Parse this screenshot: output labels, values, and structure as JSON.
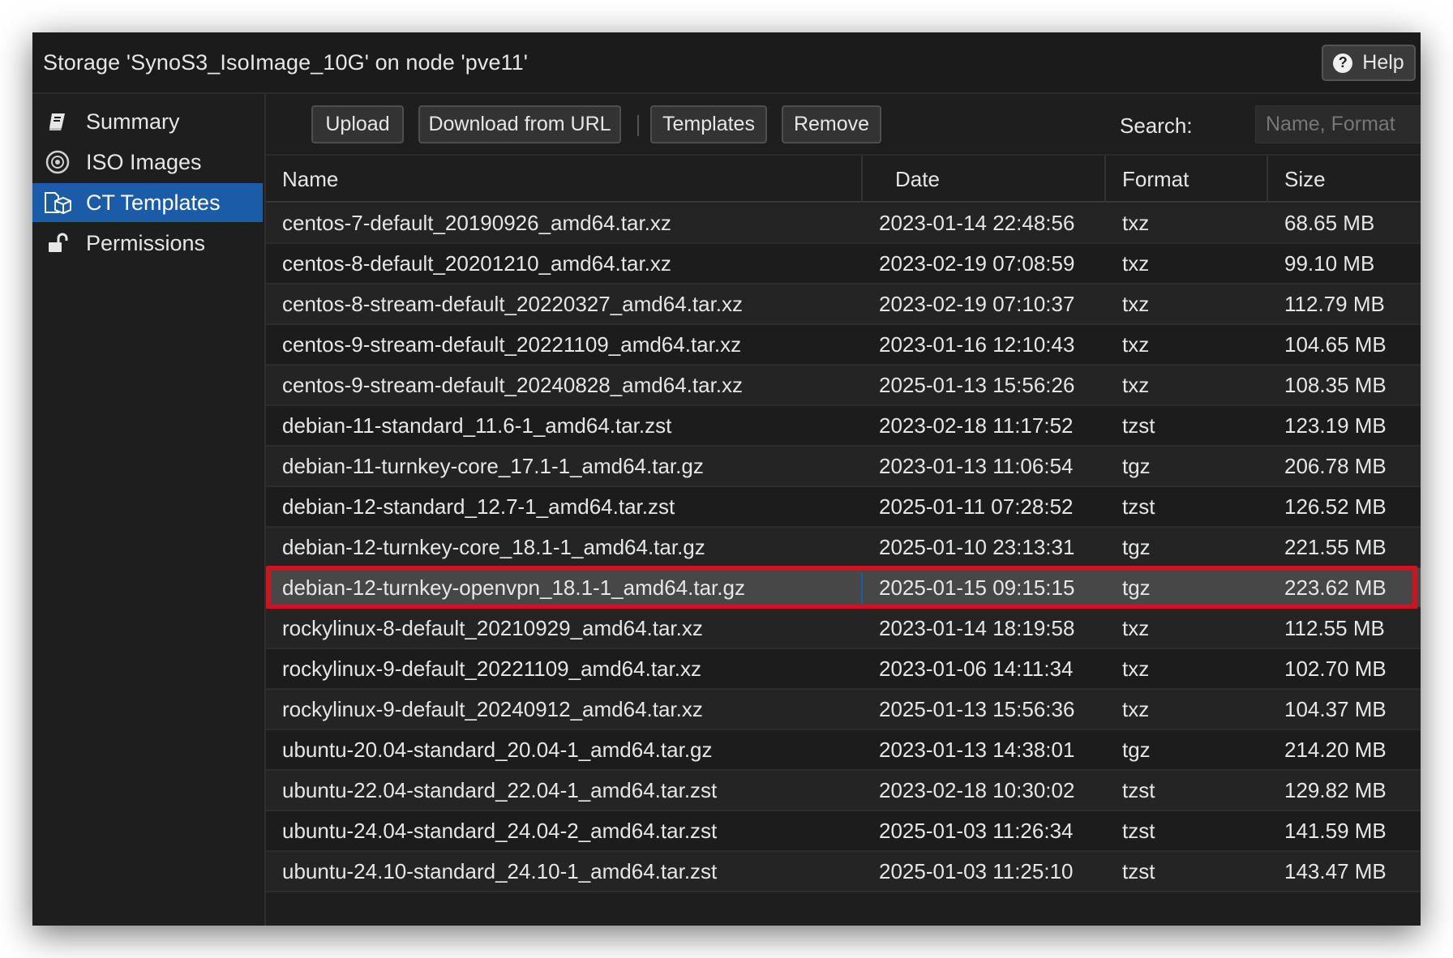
{
  "window": {
    "title": "Storage 'SynoS3_IsoImage_10G' on node 'pve11'",
    "help_label": "Help"
  },
  "sidebar": {
    "items": [
      {
        "label": "Summary",
        "icon": "book-icon"
      },
      {
        "label": "ISO Images",
        "icon": "disc-icon"
      },
      {
        "label": "CT Templates",
        "icon": "container-template-icon",
        "active": true
      },
      {
        "label": "Permissions",
        "icon": "unlock-icon"
      }
    ]
  },
  "toolbar": {
    "upload_label": "Upload",
    "download_url_label": "Download from URL",
    "templates_label": "Templates",
    "remove_label": "Remove",
    "search_label": "Search:",
    "search_placeholder": "Name, Format"
  },
  "table": {
    "columns": [
      "Name",
      "Date",
      "Format",
      "Size"
    ],
    "rows": [
      {
        "name": "centos-7-default_20190926_amd64.tar.xz",
        "date": "2023-01-14 22:48:56",
        "format": "txz",
        "size": "68.65 MB"
      },
      {
        "name": "centos-8-default_20201210_amd64.tar.xz",
        "date": "2023-02-19 07:08:59",
        "format": "txz",
        "size": "99.10 MB"
      },
      {
        "name": "centos-8-stream-default_20220327_amd64.tar.xz",
        "date": "2023-02-19 07:10:37",
        "format": "txz",
        "size": "112.79 MB"
      },
      {
        "name": "centos-9-stream-default_20221109_amd64.tar.xz",
        "date": "2023-01-16 12:10:43",
        "format": "txz",
        "size": "104.65 MB"
      },
      {
        "name": "centos-9-stream-default_20240828_amd64.tar.xz",
        "date": "2025-01-13 15:56:26",
        "format": "txz",
        "size": "108.35 MB"
      },
      {
        "name": "debian-11-standard_11.6-1_amd64.tar.zst",
        "date": "2023-02-18 11:17:52",
        "format": "tzst",
        "size": "123.19 MB"
      },
      {
        "name": "debian-11-turnkey-core_17.1-1_amd64.tar.gz",
        "date": "2023-01-13 11:06:54",
        "format": "tgz",
        "size": "206.78 MB"
      },
      {
        "name": "debian-12-standard_12.7-1_amd64.tar.zst",
        "date": "2025-01-11 07:28:52",
        "format": "tzst",
        "size": "126.52 MB"
      },
      {
        "name": "debian-12-turnkey-core_18.1-1_amd64.tar.gz",
        "date": "2025-01-10 23:13:31",
        "format": "tgz",
        "size": "221.55 MB"
      },
      {
        "name": "debian-12-turnkey-openvpn_18.1-1_amd64.tar.gz",
        "date": "2025-01-15 09:15:15",
        "format": "tgz",
        "size": "223.62 MB",
        "selected": true
      },
      {
        "name": "rockylinux-8-default_20210929_amd64.tar.xz",
        "date": "2023-01-14 18:19:58",
        "format": "txz",
        "size": "112.55 MB"
      },
      {
        "name": "rockylinux-9-default_20221109_amd64.tar.xz",
        "date": "2023-01-06 14:11:34",
        "format": "txz",
        "size": "102.70 MB"
      },
      {
        "name": "rockylinux-9-default_20240912_amd64.tar.xz",
        "date": "2025-01-13 15:56:36",
        "format": "txz",
        "size": "104.37 MB"
      },
      {
        "name": "ubuntu-20.04-standard_20.04-1_amd64.tar.gz",
        "date": "2023-01-13 14:38:01",
        "format": "tgz",
        "size": "214.20 MB"
      },
      {
        "name": "ubuntu-22.04-standard_22.04-1_amd64.tar.zst",
        "date": "2023-02-18 10:30:02",
        "format": "tzst",
        "size": "129.82 MB"
      },
      {
        "name": "ubuntu-24.04-standard_24.04-2_amd64.tar.zst",
        "date": "2025-01-03 11:26:34",
        "format": "tzst",
        "size": "141.59 MB"
      },
      {
        "name": "ubuntu-24.10-standard_24.10-1_amd64.tar.zst",
        "date": "2025-01-03 11:25:10",
        "format": "tzst",
        "size": "143.47 MB"
      }
    ]
  },
  "colors": {
    "selection_outline": "#d0141f",
    "active_nav": "#1a5ca8"
  }
}
